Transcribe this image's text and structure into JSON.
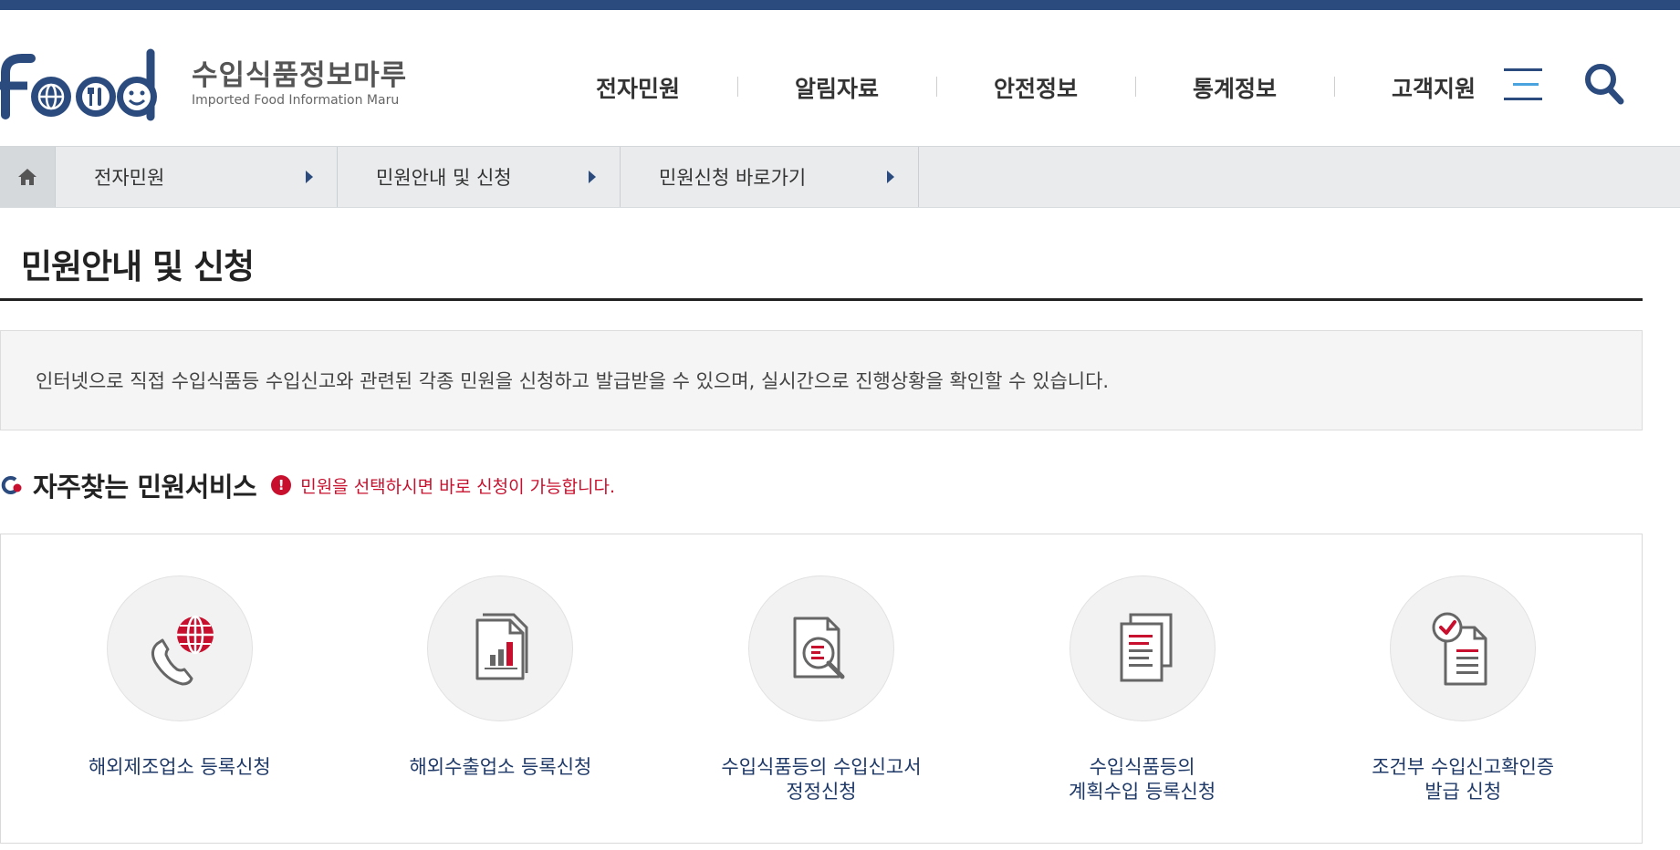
{
  "header": {
    "logo_text_ko": "수입식품정보마루",
    "logo_text_en": "Imported Food Information Maru",
    "logo_wordmark": "food",
    "nav": [
      {
        "label": "전자민원"
      },
      {
        "label": "알림자료"
      },
      {
        "label": "안전정보"
      },
      {
        "label": "통계정보"
      },
      {
        "label": "고객지원"
      }
    ],
    "menu_icon": "hamburger-menu-icon",
    "search_icon": "search-icon"
  },
  "breadcrumb": {
    "home_icon": "home-icon",
    "items": [
      {
        "label": "전자민원"
      },
      {
        "label": "민원안내 및 신청"
      },
      {
        "label": "민원신청 바로가기"
      }
    ]
  },
  "page": {
    "title": "민원안내 및 신청",
    "intro": "인터넷으로 직접 수입식품등 수입신고와 관련된 각종 민원을 신청하고 발급받을 수 있으며, 실시간으로 진행상황을 확인할 수 있습니다."
  },
  "section": {
    "title": "자주찾는 민원서비스",
    "note": "민원을 선택하시면 바로 신청이 가능합니다.",
    "alert_glyph": "!",
    "services": [
      {
        "label": "해외제조업소 등록신청",
        "icon": "phone-globe-icon"
      },
      {
        "label": "해외수출업소 등록신청",
        "icon": "document-chart-icon"
      },
      {
        "label": "수입식품등의 수입신고서\n정정신청",
        "icon": "document-search-icon"
      },
      {
        "label": "수입식품등의\n계획수입 등록신청",
        "icon": "documents-stack-icon"
      },
      {
        "label": "조건부 수입신고확인증\n발급 신청",
        "icon": "document-check-icon"
      }
    ]
  },
  "colors": {
    "brand_navy": "#2b4b7e",
    "accent_red": "#c8102e",
    "label_navy": "#1f3a68",
    "icon_gray": "#666666"
  }
}
